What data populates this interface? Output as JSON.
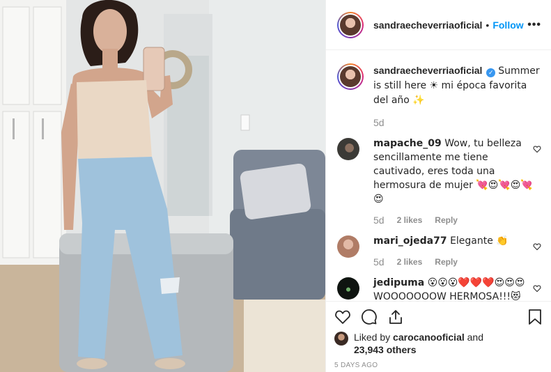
{
  "post": {
    "username": "sandraecheverriaoficial",
    "follow_label": "Follow",
    "dot": "•",
    "more_label": "•••"
  },
  "caption": {
    "username": "sandraecheverriaoficial",
    "text": "Summer is still here ☀ mi época favorita del año ✨",
    "time": "5d"
  },
  "comments": [
    {
      "username": "mapache_09",
      "text": "Wow, tu belleza sencillamente me tiene cautivado, eres toda una hermosura de mujer 💘😍💘😍💘😍",
      "time": "5d",
      "likes": "2 likes",
      "reply": "Reply",
      "avatar_color": "#3b3a36"
    },
    {
      "username": "mari_ojeda77",
      "text": "Elegante 👏",
      "time": "5d",
      "likes": "2 likes",
      "reply": "Reply",
      "avatar_color": "#c9a08e"
    },
    {
      "username": "jedipuma",
      "text": "😮😮😮❤️❤️❤️😍😍😍WOOOOOOOW HERMOSA!!!😻",
      "time": "",
      "likes": "",
      "reply": "",
      "avatar_color": "#0f1410"
    }
  ],
  "likes": {
    "liked_by_prefix": "Liked by",
    "liked_by_user": "carocanooficial",
    "and": "and",
    "count": "23,943 others"
  },
  "posted_ago": "5 DAYS AGO",
  "colors": {
    "link": "#0095f6",
    "muted": "#8e8e8e",
    "text": "#262626"
  }
}
